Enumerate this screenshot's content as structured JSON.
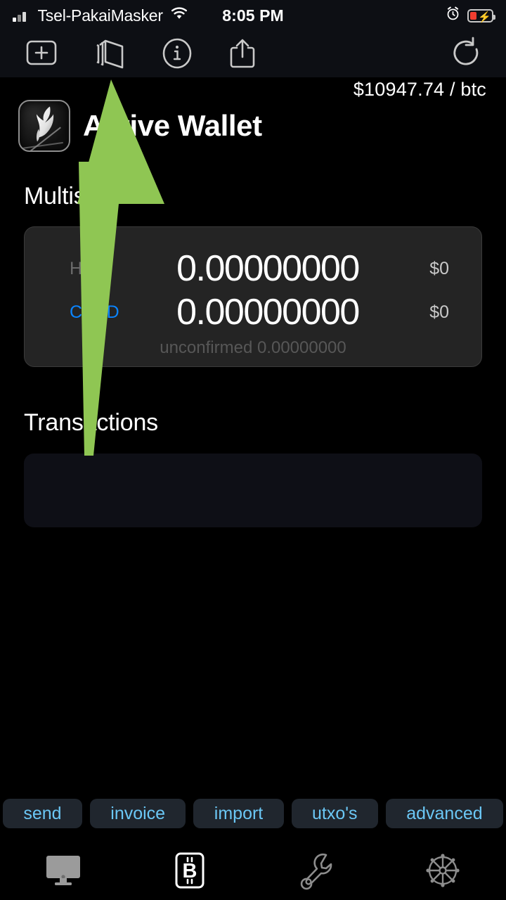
{
  "status_bar": {
    "carrier": "Tsel-PakaiMasker",
    "time": "8:05 PM",
    "signal_icon": "cellular-signal-icon",
    "wifi_icon": "wifi-icon",
    "alarm_icon": "alarm-clock-icon",
    "battery_icon": "battery-charging-low-icon"
  },
  "toolbar": {
    "add_icon": "add-square-icon",
    "layers_icon": "layers-icon",
    "info_icon": "info-circle-icon",
    "share_icon": "share-upload-icon",
    "reload_icon": "refresh-icon"
  },
  "header": {
    "price": "$10947.74 / btc",
    "app_icon": "app-logo-icon",
    "title": "Active Wallet"
  },
  "sections": {
    "multisig_title": "Multisig",
    "transactions_title": "Transactions"
  },
  "balance": {
    "rows": [
      {
        "label": "HOT",
        "amount": "0.00000000",
        "fiat": "$0",
        "color": "#6b6b6b"
      },
      {
        "label": "COLD",
        "amount": "0.00000000",
        "fiat": "$0",
        "color": "#0a84ff"
      }
    ],
    "unconfirmed": "unconfirmed 0.00000000"
  },
  "actions": [
    {
      "label": "send"
    },
    {
      "label": "invoice"
    },
    {
      "label": "import"
    },
    {
      "label": "utxo's"
    },
    {
      "label": "advanced"
    }
  ],
  "tabbar": [
    {
      "icon": "monitor-icon",
      "active": true
    },
    {
      "icon": "bitcoin-card-icon",
      "active": true
    },
    {
      "icon": "wrench-icon",
      "active": false
    },
    {
      "icon": "gear-icon",
      "active": false
    }
  ],
  "annotation": {
    "type": "arrow",
    "color": "#8fc653",
    "points_to": "layers-icon"
  },
  "colors": {
    "background": "#000000",
    "chrome": "#0d0f14",
    "card": "#242424",
    "panel": "#0e0f16",
    "action_button_bg": "#20262e",
    "action_button_text": "#6bc7f5",
    "cold_accent": "#0a84ff",
    "annotation_green": "#8fc653"
  }
}
